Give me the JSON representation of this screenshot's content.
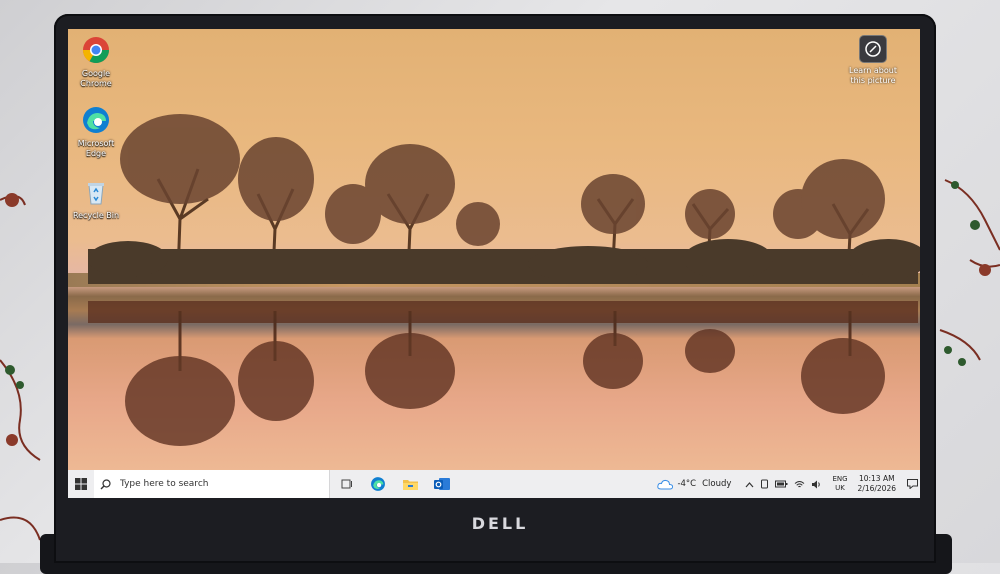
{
  "desktop_icons": [
    {
      "label": "Google Chrome",
      "icon": "chrome-icon"
    },
    {
      "label": "Microsoft Edge",
      "icon": "edge-icon"
    },
    {
      "label": "Recycle Bin",
      "icon": "recycle-bin-icon"
    }
  ],
  "learn_picture": {
    "label": "Learn about this picture",
    "icon": "camera-icon"
  },
  "taskbar": {
    "search_placeholder": "Type here to search",
    "pinned": [
      "task-view-icon",
      "edge-icon",
      "file-explorer-icon",
      "outlook-icon"
    ]
  },
  "tray": {
    "temperature": "-4°C",
    "condition": "Cloudy",
    "lang_top": "ENG",
    "lang_bottom": "UK",
    "time": "10:13 AM",
    "date": "2/16/2026"
  },
  "brand": "DELL",
  "colors": {
    "taskbar": "#eeeef0",
    "edge_blue": "#0f7fd1",
    "chrome_red": "#db4437"
  }
}
